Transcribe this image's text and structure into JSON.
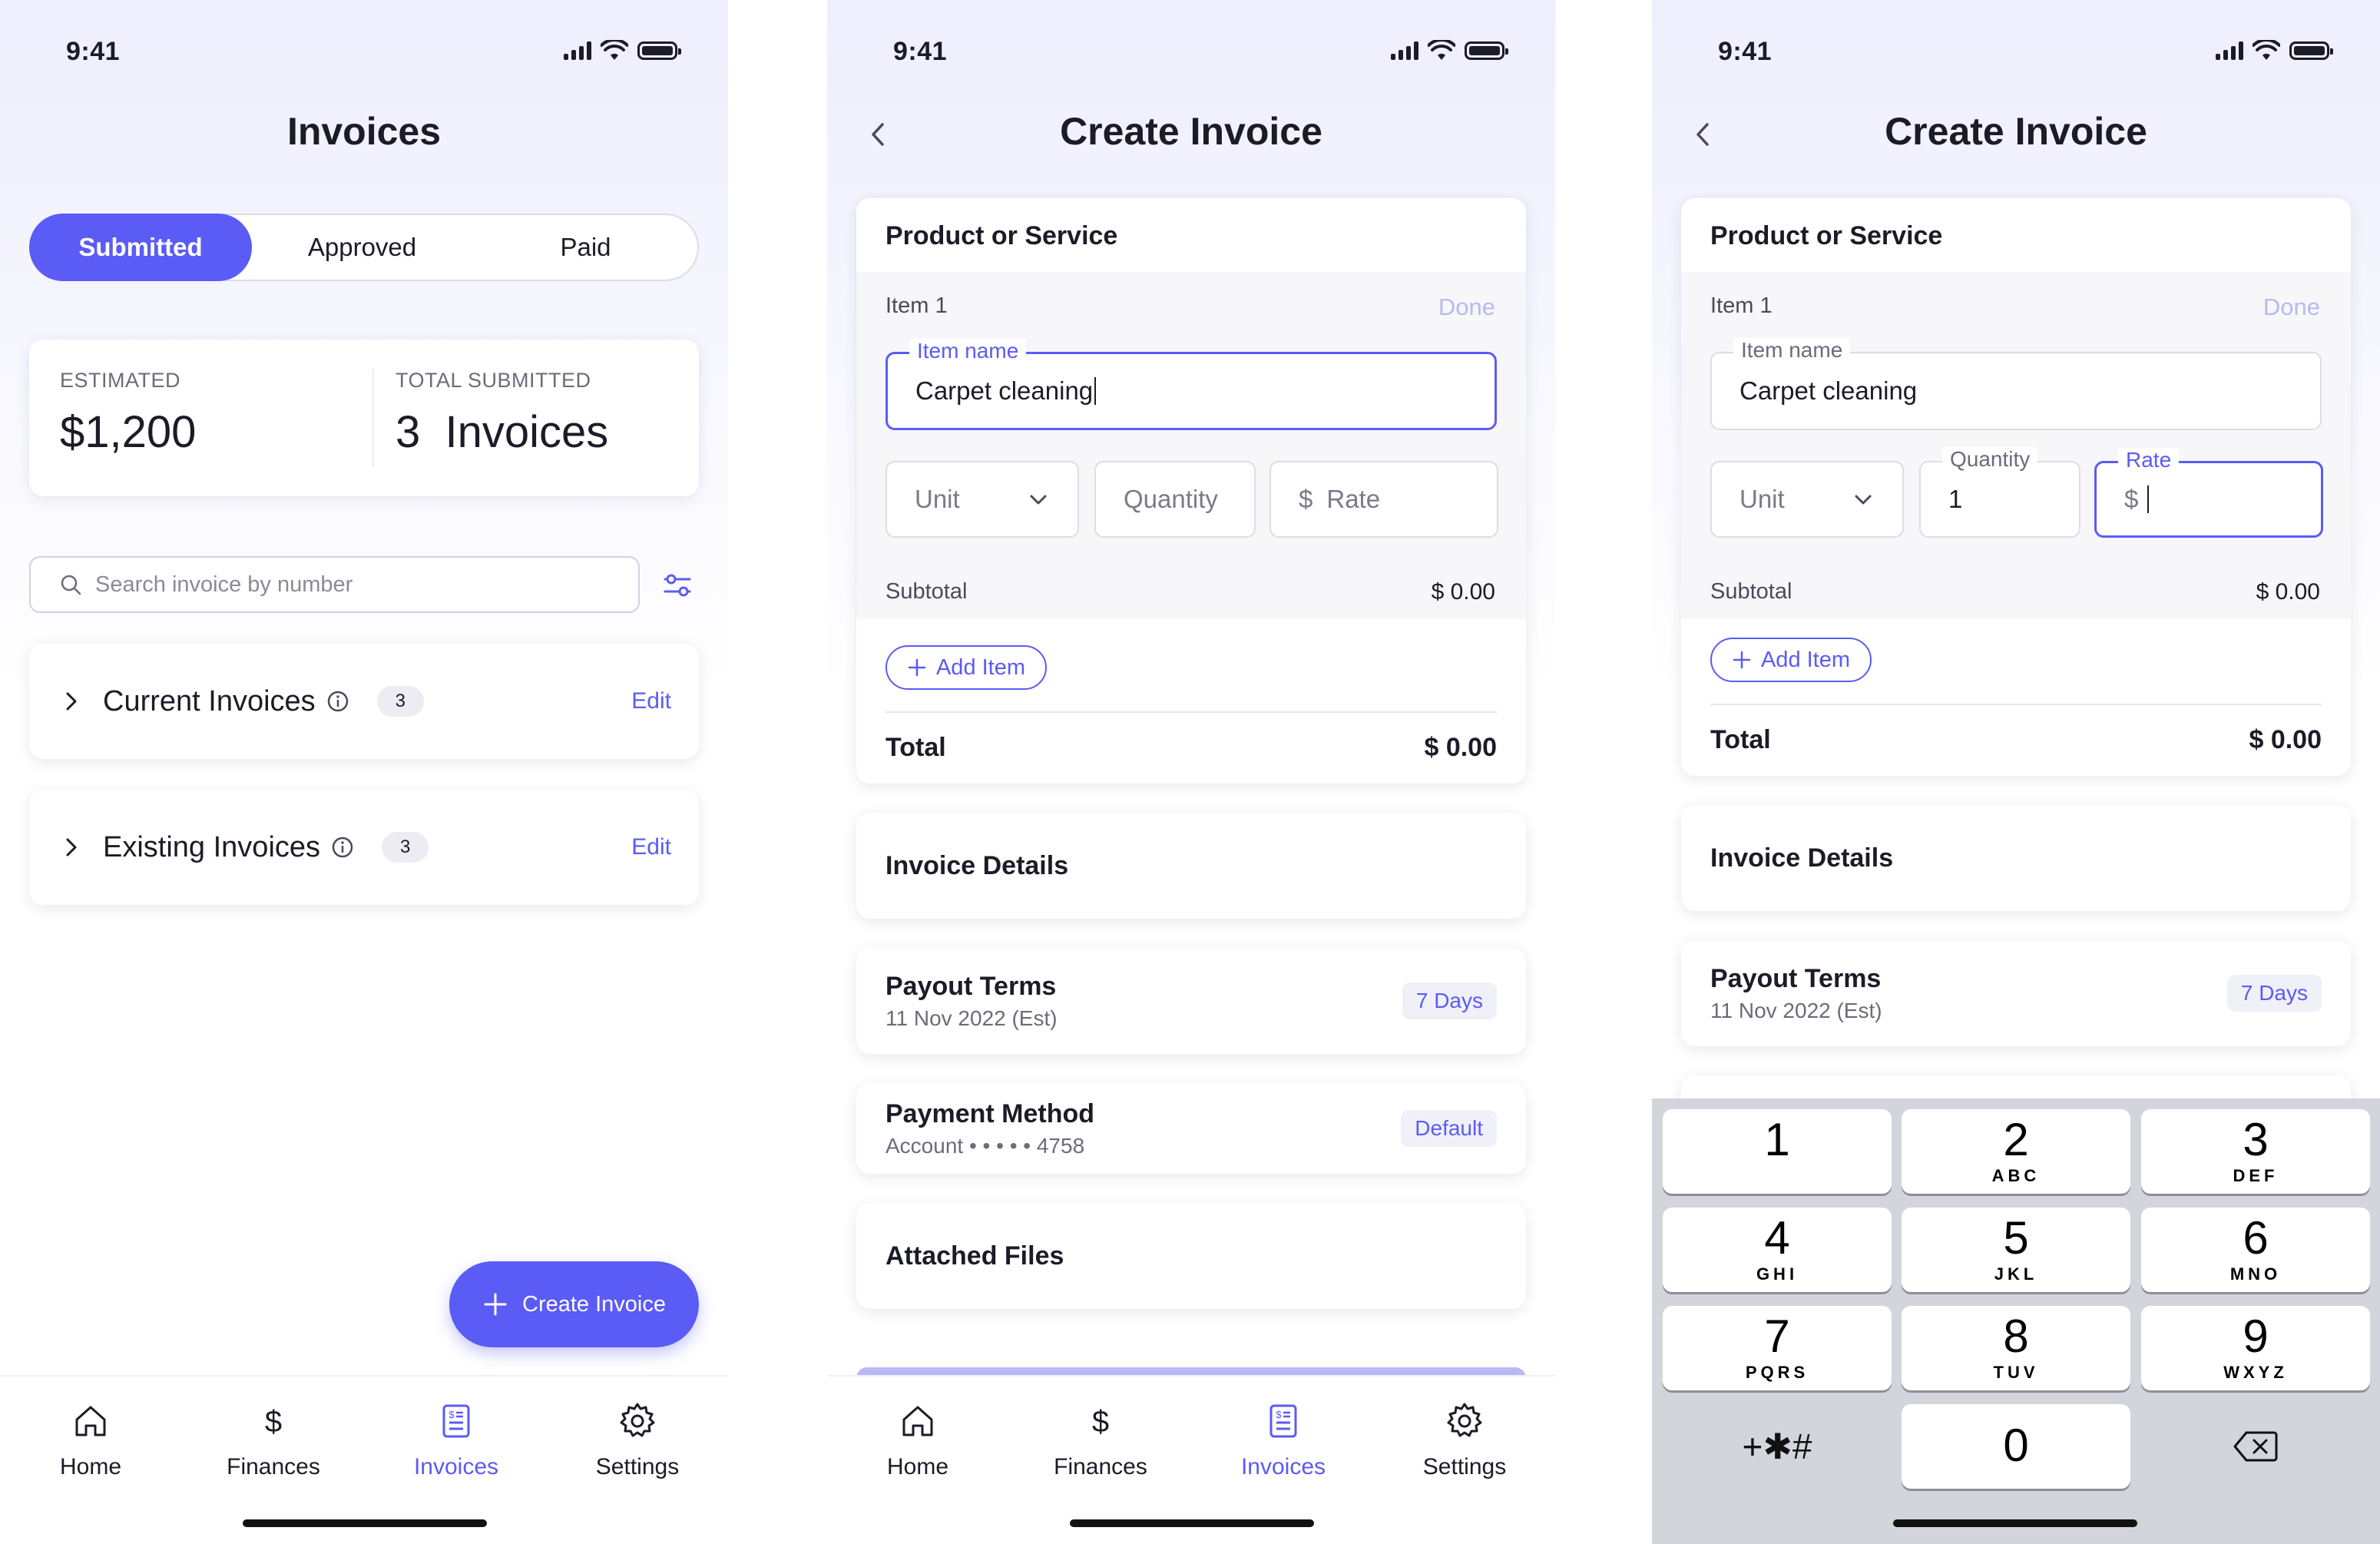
{
  "status": {
    "time": "9:41"
  },
  "screen1": {
    "title": "Invoices",
    "segments": [
      "Submitted",
      "Approved",
      "Paid"
    ],
    "stats": {
      "estimated_label": "ESTIMATED",
      "estimated_value": "$1,200",
      "total_label": "TOTAL SUBMITTED",
      "total_value": "3  Invoices"
    },
    "search_placeholder": "Search invoice by number",
    "sections": [
      {
        "title": "Current Invoices",
        "count": "3",
        "action": "Edit"
      },
      {
        "title": "Existing Invoices",
        "count": "3",
        "action": "Edit"
      }
    ],
    "fab_label": "Create Invoice"
  },
  "tabs": [
    "Home",
    "Finances",
    "Invoices",
    "Settings"
  ],
  "create": {
    "title": "Create Invoice",
    "product_header": "Product or Service",
    "item_label": "Item 1",
    "done": "Done",
    "item_name_label": "Item name",
    "item_name_value": "Carpet cleaning",
    "unit": "Unit",
    "quantity_label": "Quantity",
    "rate_label": "Rate",
    "currency": "$",
    "subtotal_label": "Subtotal",
    "subtotal_value": "$ 0.00",
    "add_item": "Add Item",
    "total_label": "Total",
    "total_value": "$ 0.00",
    "invoice_details": "Invoice Details",
    "payout_title": "Payout Terms",
    "payout_sub": "11 Nov 2022 (Est)",
    "payout_pill": "7 Days",
    "payment_title": "Payment Method",
    "payment_sub": "Account • • • • • 4758",
    "payment_pill": "Default",
    "attached_files": "Attached Files"
  },
  "screen3": {
    "quantity_value": "1",
    "keypad": [
      {
        "num": "1",
        "letters": ""
      },
      {
        "num": "2",
        "letters": "ABC"
      },
      {
        "num": "3",
        "letters": "DEF"
      },
      {
        "num": "4",
        "letters": "GHI"
      },
      {
        "num": "5",
        "letters": "JKL"
      },
      {
        "num": "6",
        "letters": "MNO"
      },
      {
        "num": "7",
        "letters": "PQRS"
      },
      {
        "num": "8",
        "letters": "TUV"
      },
      {
        "num": "9",
        "letters": "WXYZ"
      },
      {
        "num": "0",
        "letters": ""
      }
    ],
    "symbols_key": "+✱#"
  },
  "colors": {
    "accent": "#5b5bf5",
    "accent_light": "#b9b9f3",
    "text": "#1c1c28"
  },
  "icons": [
    "signal-icon",
    "wifi-icon",
    "battery-icon",
    "back-icon",
    "search-icon",
    "filter-icon",
    "chevron-right-icon",
    "info-icon",
    "plus-icon",
    "chevron-down-icon",
    "home-icon",
    "dollar-icon",
    "invoice-icon",
    "gear-icon",
    "backspace-icon"
  ]
}
